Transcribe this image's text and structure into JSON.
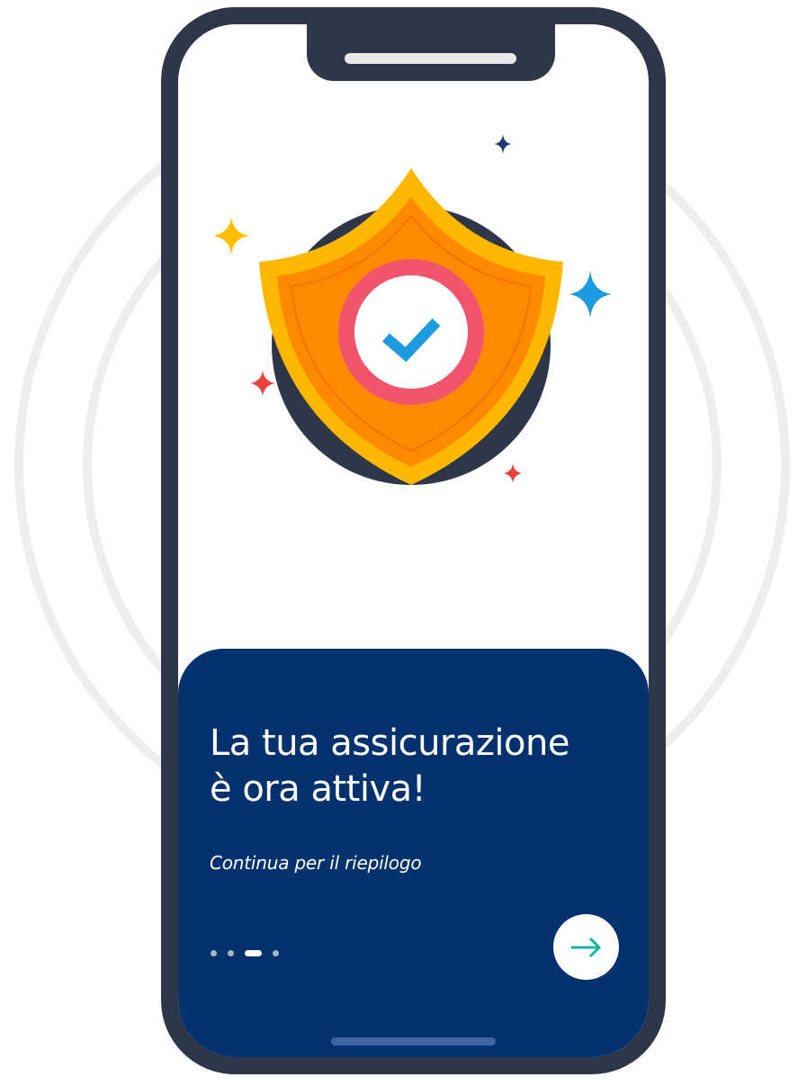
{
  "onboarding": {
    "title_line1": "La tua assicurazione",
    "title_line2": "è ora attiva!",
    "subtitle": "Continua per il riepilogo",
    "pager": {
      "total_pages": 4,
      "current_page": 3
    },
    "next_button_icon": "arrow-right-icon",
    "illustration_icon": "shield-check-icon"
  },
  "colors": {
    "panel_bg": "#04326e",
    "phone_frame": "#2d3748",
    "shield_outer": "#ffb700",
    "shield_inner": "#ff8a00",
    "check_ring": "#f2546e",
    "check_mark": "#1d9be0",
    "arrow": "#14b3a4"
  }
}
